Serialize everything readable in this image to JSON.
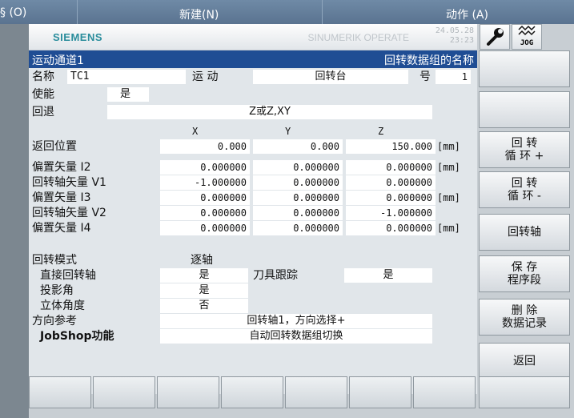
{
  "host_menu": {
    "left": "§ (O)",
    "new": "新建(N)",
    "action": "动作 (A)"
  },
  "header": {
    "brand": "SIEMENS",
    "product": "SINUMERIK OPERATE",
    "date": "24.05.28",
    "time": "23:23",
    "mode": "JOG"
  },
  "dialog": {
    "title_left": "运动通道1",
    "title_right": "回转数据组的名称",
    "name_label": "名称",
    "name_value": "TC1",
    "motion_label": "运 动",
    "motion_value": "回转台",
    "number_label": "号",
    "number_value": "1",
    "enable_label": "使能",
    "enable_value": "是",
    "retract_label": "回退",
    "retract_value": "Z或Z,XY",
    "col_x": "X",
    "col_y": "Y",
    "col_z": "Z",
    "rows": [
      {
        "label": "返回位置",
        "x": "0.000",
        "y": "0.000",
        "z": "150.000",
        "unit": "[mm]"
      },
      {
        "label": "偏置矢量 I2",
        "x": "0.000000",
        "y": "0.000000",
        "z": "0.000000",
        "unit": "[mm]"
      },
      {
        "label": "回转轴矢量 V1",
        "x": "-1.000000",
        "y": "0.000000",
        "z": "0.000000",
        "unit": ""
      },
      {
        "label": "偏置矢量 I3",
        "x": "0.000000",
        "y": "0.000000",
        "z": "0.000000",
        "unit": "[mm]"
      },
      {
        "label": "回转轴矢量 V2",
        "x": "0.000000",
        "y": "0.000000",
        "z": "-1.000000",
        "unit": ""
      },
      {
        "label": "偏置矢量 I4",
        "x": "0.000000",
        "y": "0.000000",
        "z": "0.000000",
        "unit": "[mm]"
      }
    ],
    "swivel_mode_label": "回转模式",
    "swivel_mode_value": "逐轴",
    "direct_axis_label": "直接回转轴",
    "direct_axis_value": "是",
    "tool_track_label": "刀具跟踪",
    "tool_track_value": "是",
    "projection_label": "投影角",
    "projection_value": "是",
    "solid_angle_label": "立体角度",
    "solid_angle_value": "否",
    "direction_ref_label": "方向参考",
    "direction_ref_value": "回转轴1，方向选择+",
    "jobshop_label": "JobShop功能",
    "jobshop_value": "自动回转数据组切换"
  },
  "softkeys": {
    "rot_pos_1": "回 转",
    "rot_pos_2": "循 环 +",
    "rot_neg_1": "回 转",
    "rot_neg_2": "循 环 -",
    "rot_axis": "回转轴",
    "save_1": "保 存",
    "save_2": "程序段",
    "delete_1": "删   除",
    "delete_2": "数据记录",
    "back": "返回"
  },
  "colors": {
    "title_bar": "#1f4d94",
    "brand": "#2a8d9c",
    "panel": "#e1e6ea"
  }
}
